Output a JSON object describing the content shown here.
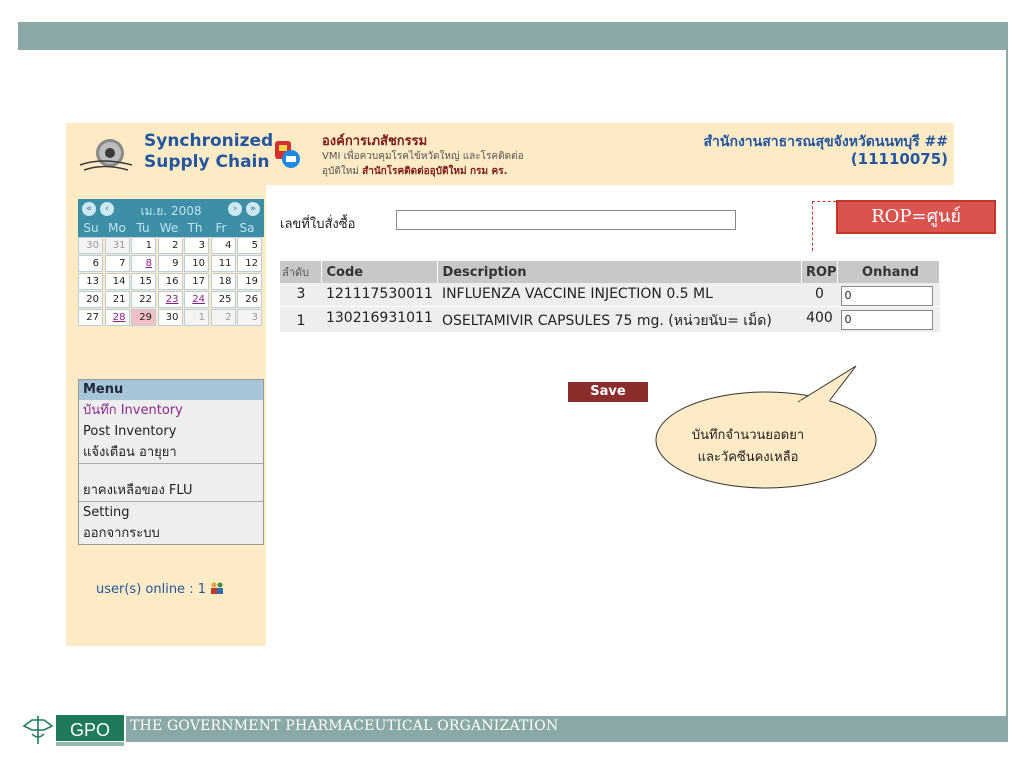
{
  "slide": {
    "footer_org": "THE GOVERNMENT PHARMACEUTICAL ORGANIZATION",
    "logo_text": "GPO",
    "callout_rop": "ROP=ศูนย์",
    "note_line1": "บันทึกจำนวนยอดยา",
    "note_line2": "และวัคซีนคงเหลือ"
  },
  "header": {
    "brand_line1": "Synchronized",
    "brand_line2": "Supply Chain",
    "org_title": "องค์การเภสัชกรรม",
    "org_sub1": "VMI เพื่อควบคุมโรคไข้หวัดใหญ่ และโรคติดต่อ",
    "org_sub2_prefix": "อุบัติใหม่",
    "org_sub2_bold": "สำนักโรคติดต่ออุบัติใหม่ กรม คร.",
    "office_name": "สำนักงานสาธารณสุขจังหวัดนนทบุรี ##",
    "office_code": "(11110075)"
  },
  "calendar": {
    "month_label": "เม.ย. 2008",
    "dow": [
      "Su",
      "Mo",
      "Tu",
      "We",
      "Th",
      "Fr",
      "Sa"
    ],
    "weeks": [
      [
        "30",
        "31",
        "1",
        "2",
        "3",
        "4",
        "5"
      ],
      [
        "6",
        "7",
        "8",
        "9",
        "10",
        "11",
        "12"
      ],
      [
        "13",
        "14",
        "15",
        "16",
        "17",
        "18",
        "19"
      ],
      [
        "20",
        "21",
        "22",
        "23",
        "24",
        "25",
        "26"
      ],
      [
        "27",
        "28",
        "29",
        "30",
        "1",
        "2",
        "3"
      ]
    ]
  },
  "menu": {
    "title": "Menu",
    "items": [
      "บันทึก Inventory",
      "Post Inventory",
      "แจ้งเตือน อายุยา",
      "ยาคงเหลือของ FLU",
      "Setting",
      "ออกจากระบบ"
    ],
    "online_text": "user(s) online : 1"
  },
  "form": {
    "po_label": "เลขที่ใบสั่งซื้อ",
    "po_value": "",
    "columns": [
      "ลำดับ",
      "Code",
      "Description",
      "ROP",
      "Onhand"
    ],
    "rows": [
      {
        "order": "3",
        "code": "121117530011",
        "description": "INFLUENZA VACCINE INJECTION 0.5 ML",
        "rop": "0",
        "onhand": "0"
      },
      {
        "order": "1",
        "code": "130216931011",
        "description": "OSELTAMIVIR CAPSULES 75 mg. (หน่วยนับ= เม็ด)",
        "rop": "400",
        "onhand": "0"
      }
    ],
    "save_label": "Save"
  }
}
